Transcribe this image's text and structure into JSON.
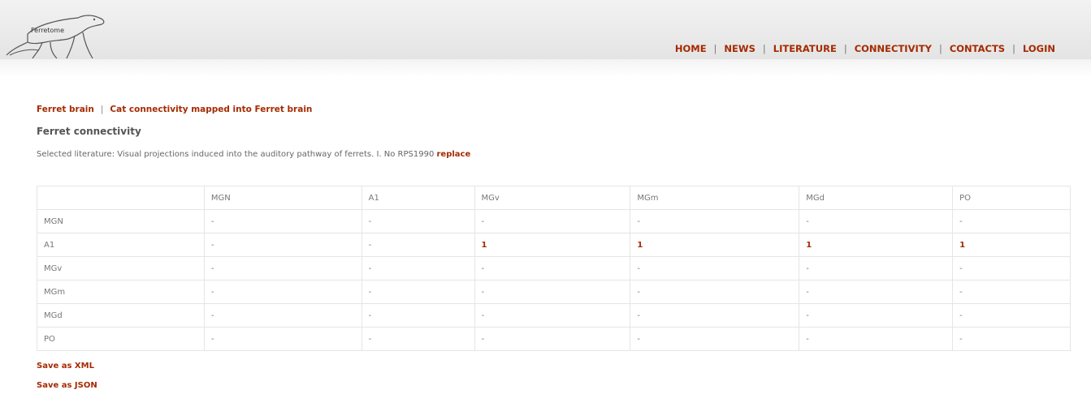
{
  "header": {
    "logo_text": "Ferretome",
    "nav": [
      {
        "label": "HOME"
      },
      {
        "label": "NEWS"
      },
      {
        "label": "LITERATURE"
      },
      {
        "label": "CONNECTIVITY"
      },
      {
        "label": "CONTACTS"
      },
      {
        "label": "LOGIN"
      }
    ],
    "separator": "|"
  },
  "subnav": {
    "items": [
      {
        "label": "Ferret brain"
      },
      {
        "label": "Cat connectivity mapped into Ferret brain"
      }
    ],
    "separator": "|"
  },
  "page": {
    "title": "Ferret connectivity",
    "literature_prefix": "Selected literature: Visual projections induced into the auditory pathway of ferrets. I. No RPS1990",
    "replace_label": "replace"
  },
  "table": {
    "columns": [
      "",
      "MGN",
      "A1",
      "MGv",
      "MGm",
      "MGd",
      "PO"
    ],
    "rows": [
      {
        "label": "MGN",
        "cells": [
          "-",
          "-",
          "-",
          "-",
          "-",
          "-"
        ]
      },
      {
        "label": "A1",
        "cells": [
          "-",
          "-",
          "1",
          "1",
          "1",
          "1"
        ]
      },
      {
        "label": "MGv",
        "cells": [
          "-",
          "-",
          "-",
          "-",
          "-",
          "-"
        ]
      },
      {
        "label": "MGm",
        "cells": [
          "-",
          "-",
          "-",
          "-",
          "-",
          "-"
        ]
      },
      {
        "label": "MGd",
        "cells": [
          "-",
          "-",
          "-",
          "-",
          "-",
          "-"
        ]
      },
      {
        "label": "PO",
        "cells": [
          "-",
          "-",
          "-",
          "-",
          "-",
          "-"
        ]
      }
    ]
  },
  "actions": {
    "save_xml": "Save as XML",
    "save_json": "Save as JSON"
  },
  "colors": {
    "accent": "#a52a00",
    "header_bg": "#e8e8e8",
    "table_border": "#e5e5e5"
  },
  "icons": {
    "logo": "ferret-logo-icon"
  }
}
